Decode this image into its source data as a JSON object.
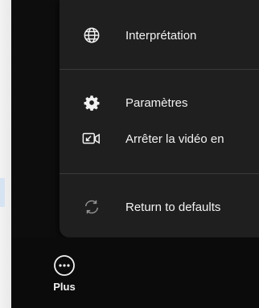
{
  "menu": {
    "items": [
      {
        "label": "Interprétation",
        "icon": "globe-icon"
      },
      {
        "label": "Paramètres",
        "icon": "gear-icon"
      },
      {
        "label": "Arrêter la vidéo en",
        "icon": "video-stop-icon"
      },
      {
        "label": "Return to defaults",
        "icon": "reset-icon"
      }
    ]
  },
  "toolbar": {
    "more_label": "Plus",
    "more_icon": "more-icon"
  },
  "colors": {
    "panel": "#1f1f1f",
    "frame": "#0d0d0d",
    "text": "#f2f2f2",
    "divider": "#3a3a3a"
  }
}
